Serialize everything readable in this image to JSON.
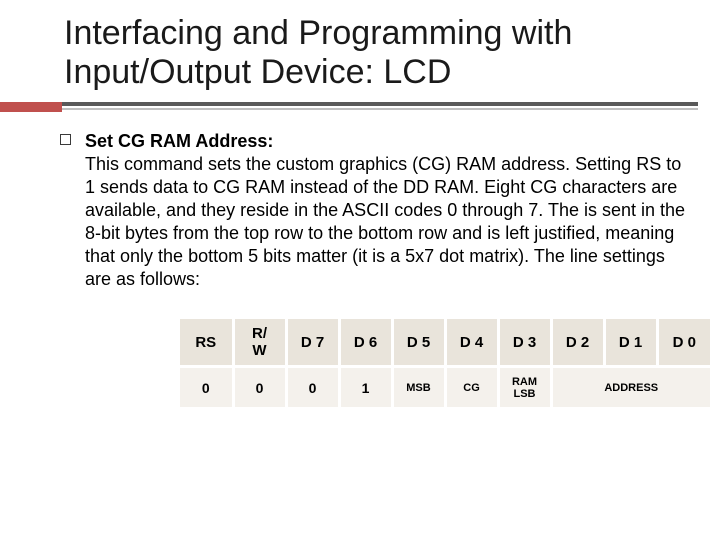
{
  "title": "Interfacing and Programming with Input/Output Device: LCD",
  "section": {
    "heading": "Set CG RAM Address:",
    "body": "This command sets the custom graphics (CG) RAM address. Setting RS to 1 sends data to CG RAM instead of the DD RAM. Eight CG characters are available, and they reside in the ASCII codes 0 through 7. The is sent in the 8-bit bytes from the top row to the bottom row and is left justified, meaning that only the bottom 5 bits matter (it is a 5x7 dot matrix). The line settings are as follows:"
  },
  "table": {
    "headers": [
      "RS",
      "R/\nW",
      "D 7",
      "D 6",
      "D 5",
      "D 4",
      "D 3",
      "D 2",
      "D 1",
      "D 0"
    ],
    "row": {
      "rs": "0",
      "rw": "0",
      "d7": "0",
      "d6": "1",
      "d5": "MSB",
      "d4": "CG",
      "d3": "RAM LSB",
      "addr": "ADDRESS"
    }
  }
}
